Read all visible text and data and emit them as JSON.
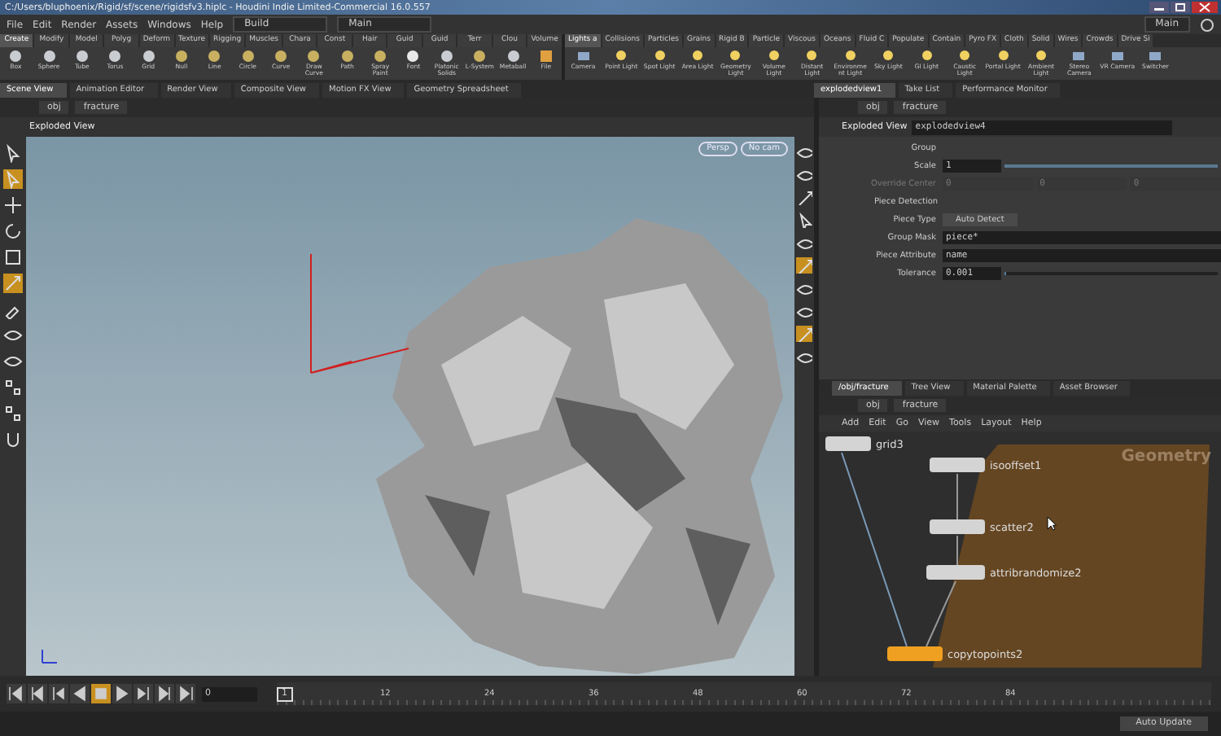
{
  "window": {
    "title": "C:/Users/bluphoenix/Rigid/sf/scene/rigidsfv3.hiplc - Houdini Indie Limited-Commercial 16.0.557"
  },
  "menu": [
    "File",
    "Edit",
    "Render",
    "Assets",
    "Windows",
    "Help"
  ],
  "desktop_menu": {
    "value": "Build"
  },
  "network_menu": {
    "value": "Main"
  },
  "right_menu": {
    "value": "Main"
  },
  "shelf_tabs_left": [
    {
      "label": "Create",
      "selected": true
    },
    {
      "label": "Modify",
      "selected": false
    },
    {
      "label": "Model",
      "selected": false
    },
    {
      "label": "Polyg",
      "selected": false
    },
    {
      "label": "Deform",
      "selected": false
    },
    {
      "label": "Texture",
      "selected": false
    },
    {
      "label": "Rigging",
      "selected": false
    },
    {
      "label": "Muscles",
      "selected": false
    },
    {
      "label": "Chara",
      "selected": false
    },
    {
      "label": "Const",
      "selected": false
    },
    {
      "label": "Hair",
      "selected": false
    },
    {
      "label": "Guid",
      "selected": false
    },
    {
      "label": "Guid",
      "selected": false
    },
    {
      "label": "Terr",
      "selected": false
    },
    {
      "label": "Clou",
      "selected": false
    },
    {
      "label": "Volume",
      "selected": false
    }
  ],
  "shelf_tabs_right": [
    {
      "label": "Lights a",
      "selected": true
    },
    {
      "label": "Collisions",
      "selected": false
    },
    {
      "label": "Particles",
      "selected": false
    },
    {
      "label": "Grains",
      "selected": false
    },
    {
      "label": "Rigid B",
      "selected": false
    },
    {
      "label": "Particle",
      "selected": false
    },
    {
      "label": "Viscous",
      "selected": false
    },
    {
      "label": "Oceans",
      "selected": false
    },
    {
      "label": "Fluid C",
      "selected": false
    },
    {
      "label": "Populate",
      "selected": false
    },
    {
      "label": "Contain",
      "selected": false
    },
    {
      "label": "Pyro FX",
      "selected": false
    },
    {
      "label": "Cloth",
      "selected": false
    },
    {
      "label": "Solid",
      "selected": false
    },
    {
      "label": "Wires",
      "selected": false
    },
    {
      "label": "Crowds",
      "selected": false
    },
    {
      "label": "Drive Si",
      "selected": false
    }
  ],
  "shelf_tools_left": [
    {
      "label": "Box",
      "kind": "geo"
    },
    {
      "label": "Sphere",
      "kind": "geo"
    },
    {
      "label": "Tube",
      "kind": "geo"
    },
    {
      "label": "Torus",
      "kind": "geo"
    },
    {
      "label": "Grid",
      "kind": "geo"
    },
    {
      "label": "Null",
      "kind": "curve"
    },
    {
      "label": "Line",
      "kind": "curve"
    },
    {
      "label": "Circle",
      "kind": "curve"
    },
    {
      "label": "Curve",
      "kind": "curve"
    },
    {
      "label": "Draw Curve",
      "kind": "curve"
    },
    {
      "label": "Path",
      "kind": "curve"
    },
    {
      "label": "Spray Paint",
      "kind": "curve"
    },
    {
      "label": "Font",
      "kind": "font"
    },
    {
      "label": "Platonic Solids",
      "kind": "geo"
    },
    {
      "label": "L-System",
      "kind": "curve"
    },
    {
      "label": "Metaball",
      "kind": "geo"
    },
    {
      "label": "File",
      "kind": "file"
    }
  ],
  "shelf_tools_right": [
    {
      "label": "Camera",
      "kind": "camera"
    },
    {
      "label": "Point Light",
      "kind": "light"
    },
    {
      "label": "Spot Light",
      "kind": "light"
    },
    {
      "label": "Area Light",
      "kind": "light"
    },
    {
      "label": "Geometry Light",
      "kind": "light"
    },
    {
      "label": "Volume Light",
      "kind": "light"
    },
    {
      "label": "Distant Light",
      "kind": "light"
    },
    {
      "label": "Environment Light",
      "kind": "light"
    },
    {
      "label": "Sky Light",
      "kind": "light"
    },
    {
      "label": "GI Light",
      "kind": "light"
    },
    {
      "label": "Caustic Light",
      "kind": "light"
    },
    {
      "label": "Portal Light",
      "kind": "light"
    },
    {
      "label": "Ambient Light",
      "kind": "light"
    },
    {
      "label": "Stereo Camera",
      "kind": "camera"
    },
    {
      "label": "VR Camera",
      "kind": "camera"
    },
    {
      "label": "Switcher",
      "kind": "camera"
    }
  ],
  "pane_tabs_left": [
    {
      "label": "Scene View",
      "selected": true
    },
    {
      "label": "Animation Editor",
      "selected": false
    },
    {
      "label": "Render View",
      "selected": false
    },
    {
      "label": "Composite View",
      "selected": false
    },
    {
      "label": "Motion FX View",
      "selected": false
    },
    {
      "label": "Geometry Spreadsheet",
      "selected": false
    }
  ],
  "pane_tabs_right": [
    {
      "label": "explodedview1",
      "selected": true
    },
    {
      "label": "Take List",
      "selected": false
    },
    {
      "label": "Performance Monitor",
      "selected": false
    }
  ],
  "viewport": {
    "path": [
      "obj",
      "fracture"
    ],
    "tool_title": "Exploded View",
    "camera_buttons": [
      "Persp",
      "No cam"
    ],
    "left_tools": [
      {
        "kind": "select",
        "selected": false
      },
      {
        "kind": "select",
        "selected": true
      },
      {
        "kind": "move",
        "selected": false
      },
      {
        "kind": "rotate",
        "selected": false
      },
      {
        "kind": "scale",
        "selected": false
      },
      {
        "kind": "handle",
        "selected": true
      },
      {
        "kind": "brush",
        "selected": false
      },
      {
        "kind": "view",
        "selected": false
      },
      {
        "kind": "view",
        "selected": false
      },
      {
        "kind": "snap",
        "selected": false
      },
      {
        "kind": "snap",
        "selected": false
      },
      {
        "kind": "magnet",
        "selected": false
      }
    ],
    "right_tools": [
      {
        "kind": "view",
        "selected": false
      },
      {
        "kind": "view",
        "selected": false
      },
      {
        "kind": "handle",
        "selected": false
      },
      {
        "kind": "select",
        "selected": false
      },
      {
        "kind": "view",
        "selected": false
      },
      {
        "kind": "handle",
        "selected": true
      },
      {
        "kind": "view",
        "selected": false
      },
      {
        "kind": "view",
        "selected": false
      },
      {
        "kind": "handle",
        "selected": true
      },
      {
        "kind": "view",
        "selected": false
      }
    ]
  },
  "parameters": {
    "path": [
      "obj",
      "fracture"
    ],
    "node_type": "Exploded View",
    "node_name": "explodedview4",
    "fields": [
      {
        "label": "Group",
        "kind": "text",
        "disabled": false
      },
      {
        "label": "Scale",
        "kind": "slider",
        "value": "1",
        "level": 1,
        "disabled": false
      },
      {
        "label": "Override Center",
        "kind": "vector",
        "values": [
          "0",
          "0",
          "0"
        ],
        "disabled": true
      },
      {
        "label": "Piece Detection",
        "kind": "heading",
        "disabled": false
      },
      {
        "label": "Piece Type",
        "kind": "menu",
        "value": "Auto Detect",
        "disabled": false
      },
      {
        "label": "Group Mask",
        "kind": "text",
        "value": "piece*",
        "disabled": false
      },
      {
        "label": "Piece Attribute",
        "kind": "text",
        "value": "name",
        "disabled": false
      },
      {
        "label": "Tolerance",
        "kind": "slider",
        "value": "0.001",
        "level": 0.01,
        "disabled": false
      }
    ]
  },
  "network": {
    "tabs": [
      {
        "label": "/obj/fracture",
        "selected": true
      },
      {
        "label": "Tree View",
        "selected": false
      },
      {
        "label": "Material Palette",
        "selected": false
      },
      {
        "label": "Asset Browser",
        "selected": false
      }
    ],
    "path": [
      "obj",
      "fracture"
    ],
    "menu": [
      "Add",
      "Edit",
      "Go",
      "View",
      "Tools",
      "Layout",
      "Help"
    ],
    "box_label": "Geometry",
    "nodes": [
      {
        "name": "grid3",
        "color": "#d4d4d4"
      },
      {
        "name": "isooffset1",
        "color": "#d4d4d4"
      },
      {
        "name": "scatter2",
        "color": "#d4d4d4"
      },
      {
        "name": "attribrandomize2",
        "color": "#d4d4d4"
      },
      {
        "name": "copytopoints2",
        "color": "#f0a020"
      }
    ]
  },
  "playback": [
    {
      "kind": "first",
      "selected": false
    },
    {
      "kind": "prev-key",
      "selected": false
    },
    {
      "kind": "step-back",
      "selected": false
    },
    {
      "kind": "play-back",
      "selected": false
    },
    {
      "kind": "stop",
      "selected": true
    },
    {
      "kind": "play",
      "selected": false
    },
    {
      "kind": "step-forward",
      "selected": false
    },
    {
      "kind": "next-key",
      "selected": false
    },
    {
      "kind": "last",
      "selected": false
    }
  ],
  "timeline": {
    "frame": "0",
    "current": "1",
    "ticks": [
      "12",
      "24",
      "36",
      "48",
      "60",
      "72",
      "84"
    ]
  },
  "status_bar": {
    "update_button": "Auto Update"
  }
}
